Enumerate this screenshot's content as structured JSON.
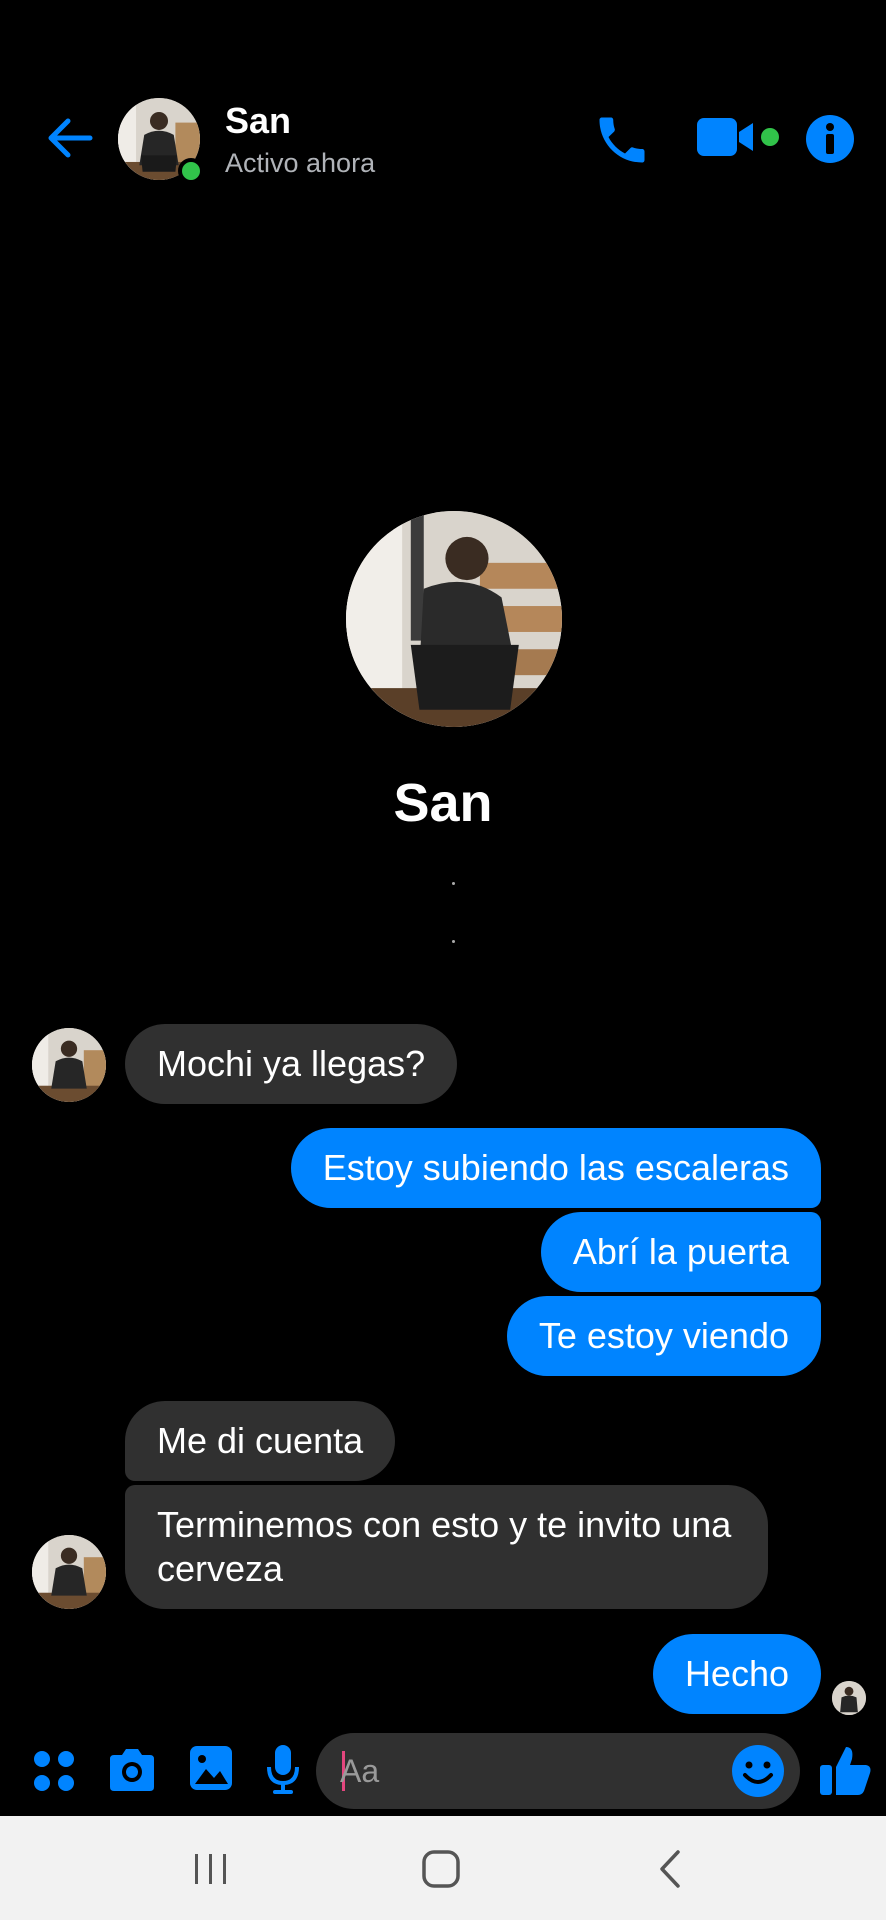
{
  "header": {
    "contact_name": "San",
    "status": "Activo ahora"
  },
  "profile": {
    "name": "San"
  },
  "messages": [
    {
      "direction": "incoming",
      "text": "Mochi ya llegas?"
    },
    {
      "direction": "outgoing",
      "text": "Estoy subiendo las escaleras"
    },
    {
      "direction": "outgoing",
      "text": "Abrí la puerta"
    },
    {
      "direction": "outgoing",
      "text": "Te estoy viendo"
    },
    {
      "direction": "incoming",
      "text": "Me di cuenta"
    },
    {
      "direction": "incoming",
      "text": "Terminemos con esto y te invito una cerveza"
    },
    {
      "direction": "outgoing",
      "text": "Hecho"
    }
  ],
  "composer": {
    "placeholder": "Aa"
  },
  "colors": {
    "accent": "#0084ff",
    "online": "#31c34a",
    "incoming_bubble": "#303030",
    "background": "#000000"
  },
  "icons": {
    "header": [
      "back-arrow-icon",
      "phone-icon",
      "video-camera-icon",
      "info-icon"
    ],
    "composer": [
      "apps-grid-icon",
      "camera-icon",
      "gallery-icon",
      "microphone-icon",
      "emoji-icon",
      "thumbs-up-icon"
    ],
    "navigation": [
      "recents-icon",
      "home-icon",
      "back-icon"
    ]
  }
}
